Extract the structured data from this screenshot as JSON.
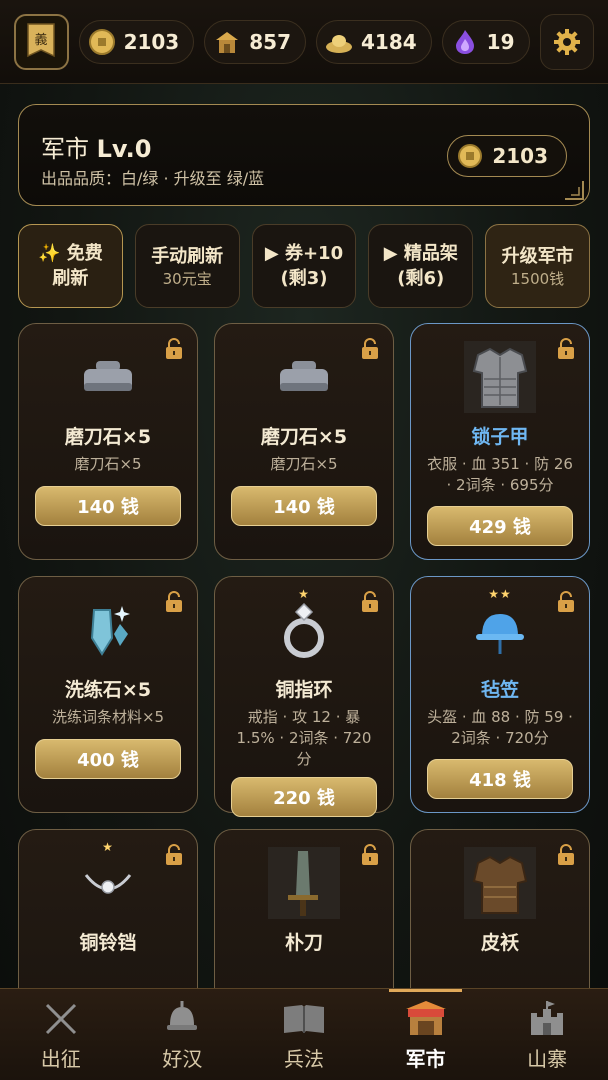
{
  "topbar": {
    "avatar_char": "義",
    "coins": "2103",
    "grain": "857",
    "silver": "4184",
    "crystal": "19"
  },
  "market": {
    "title_name": "军市",
    "title_level": "Lv.0",
    "subtitle": "出品品质：白/绿 · 升级至 绿/蓝",
    "coins": "2103"
  },
  "actions": [
    {
      "line1": "✨ 免费",
      "line2": "刷新"
    },
    {
      "line1": "手动刷新",
      "line2": "30元宝"
    },
    {
      "line1": "▶ 券+10",
      "line2": "(剩3)"
    },
    {
      "line1": "▶ 精品架",
      "line2": "(剩6)"
    },
    {
      "line1": "升级军市",
      "line2": "1500钱"
    }
  ],
  "items": [
    {
      "name": "磨刀石×5",
      "desc": "磨刀石×5",
      "price": "140 钱",
      "icon": "whetstone-icon"
    },
    {
      "name": "磨刀石×5",
      "desc": "磨刀石×5",
      "price": "140 钱",
      "icon": "whetstone-icon"
    },
    {
      "name": "锁子甲",
      "desc": "衣服 · 血 351 · 防 26 · 2词条 · 695分",
      "price": "429 钱",
      "icon": "chainmail-icon"
    },
    {
      "name": "洗练石×5",
      "desc": "洗练词条材料×5",
      "price": "400 钱",
      "icon": "crystal-icon"
    },
    {
      "name": "铜指环",
      "desc": "戒指 · 攻 12 · 暴 1.5% · 2词条 · 720 分",
      "price": "220 钱",
      "icon": "ring-icon"
    },
    {
      "name": "毡笠",
      "desc": "头盔 · 血 88 · 防 59 · 2词条 · 720分",
      "price": "418 钱",
      "icon": "hat-icon"
    },
    {
      "name": "铜铃铛",
      "desc": "",
      "price": "",
      "icon": "necklace-icon"
    },
    {
      "name": "朴刀",
      "desc": "",
      "price": "",
      "icon": "blade-icon"
    },
    {
      "name": "皮袄",
      "desc": "",
      "price": "",
      "icon": "leather-armor-icon"
    }
  ],
  "nav": [
    {
      "label": "出征",
      "icon": "crossed-swords-icon"
    },
    {
      "label": "好汉",
      "icon": "helmet-icon"
    },
    {
      "label": "兵法",
      "icon": "book-icon"
    },
    {
      "label": "军市",
      "icon": "market-stall-icon"
    },
    {
      "label": "山寨",
      "icon": "fortress-icon"
    }
  ],
  "colors": {
    "gold": "#c9a55d",
    "blue_quality": "#6fb7f2",
    "background": "#121612"
  }
}
